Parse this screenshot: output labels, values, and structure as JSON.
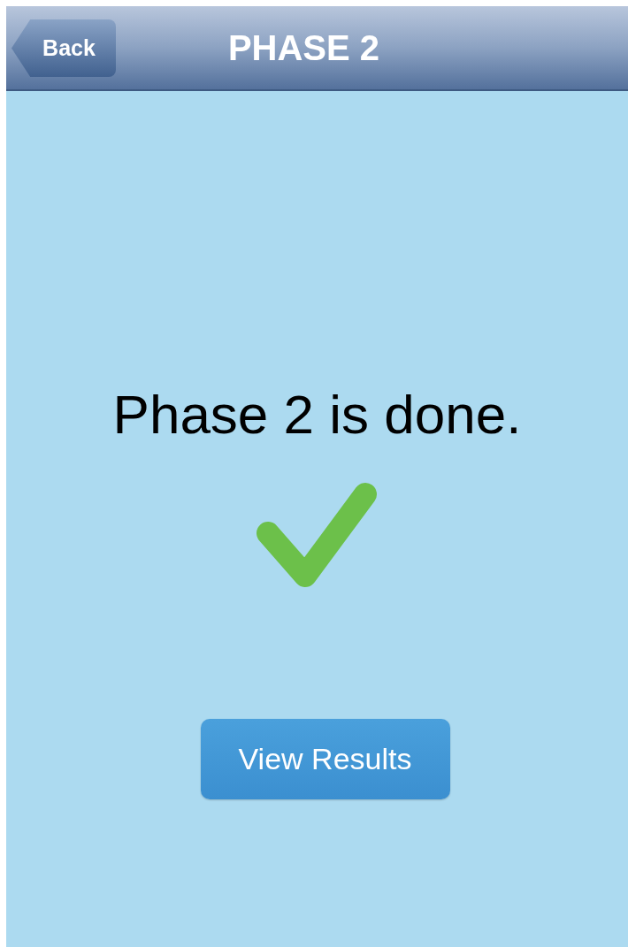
{
  "nav_bar": {
    "back_button": "Back",
    "title": "PHASE 2"
  },
  "message": "Phase 2 is done.",
  "button": "View Results"
}
